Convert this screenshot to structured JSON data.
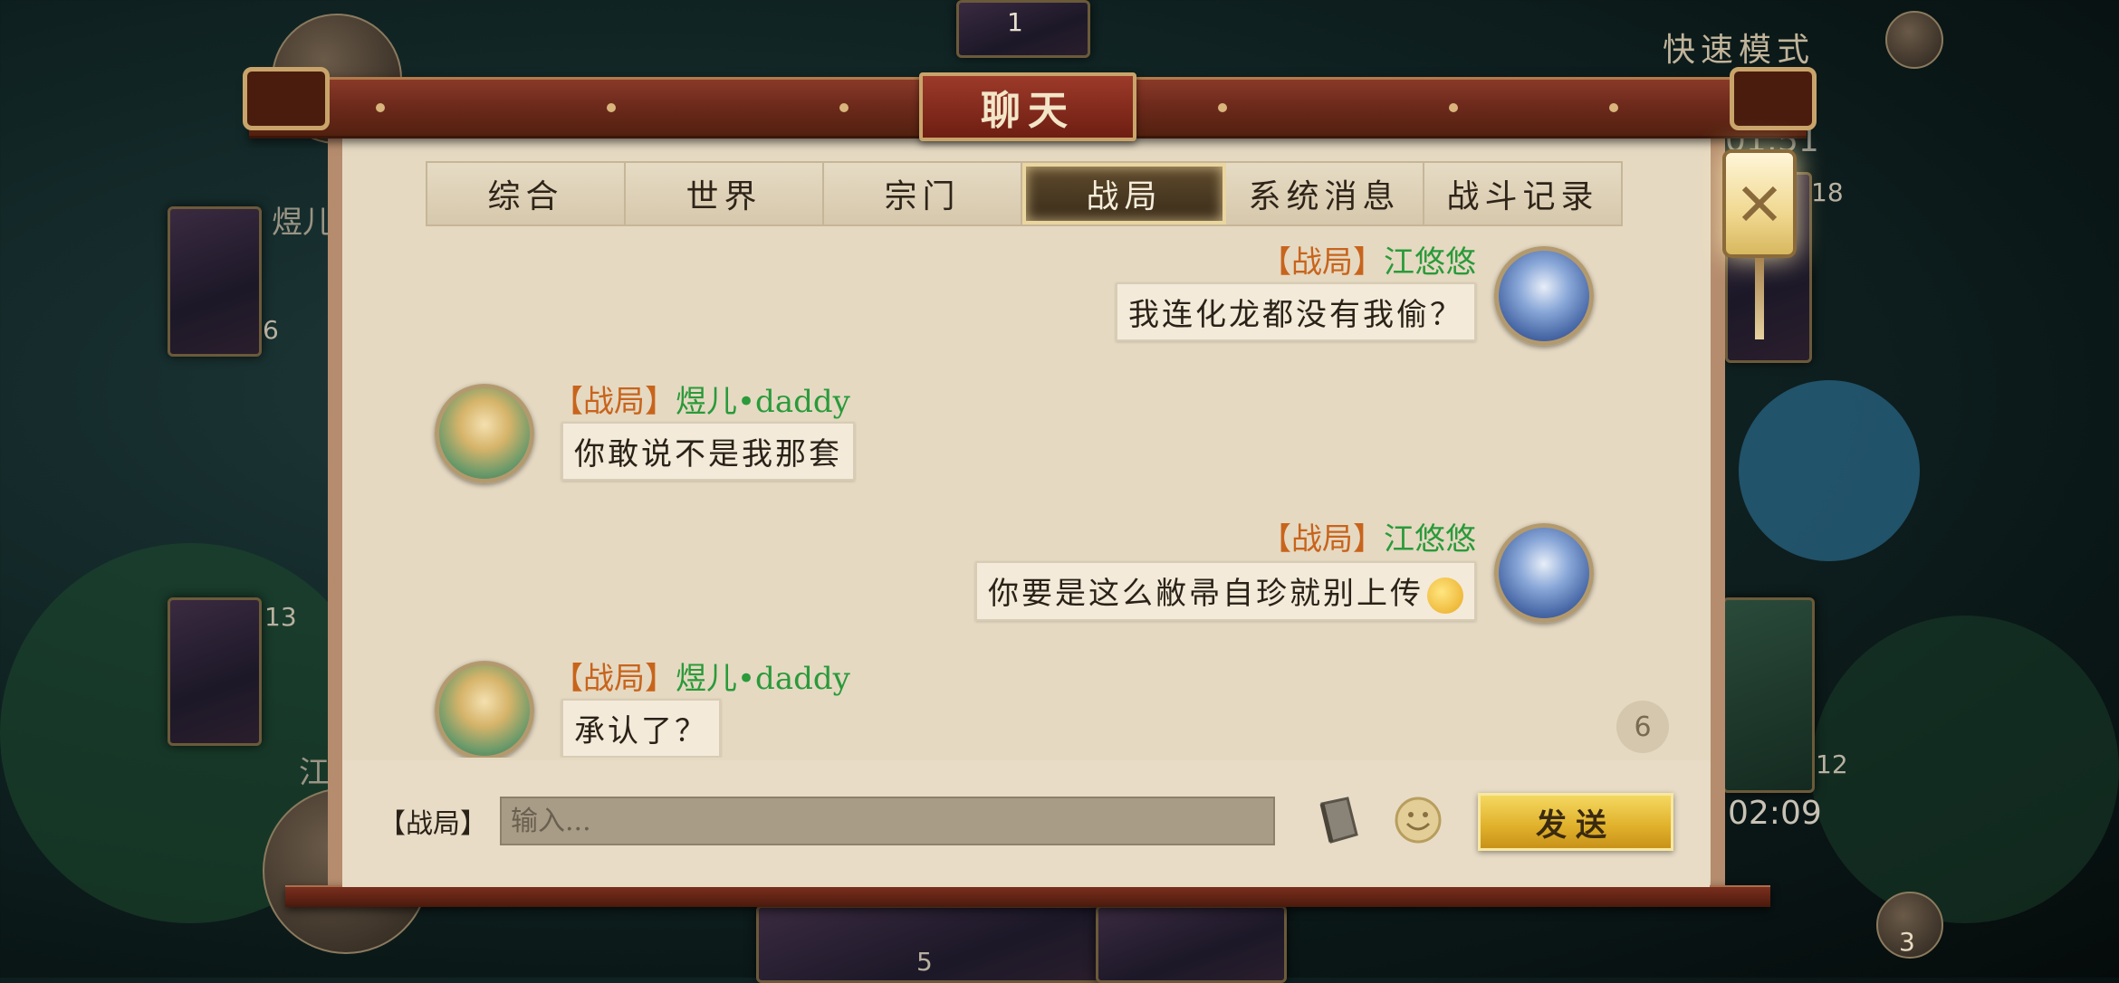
{
  "background": {
    "mode_label": "快速模式",
    "left_player_name": "煜儿",
    "left_card_count_top": "6",
    "left_card_count_bottom": "13",
    "top_card_count": "1",
    "right_card_count_top": "18",
    "right_card_count_bottom": "12",
    "right_player_name_partial": "江",
    "timer": "02:09",
    "timer_partial": "01:51",
    "bottom_card_count": "5",
    "bottom_right_count": "3"
  },
  "dialog": {
    "title": "聊天",
    "close_label": "关闭"
  },
  "tabs": [
    {
      "label": "综合",
      "active": false
    },
    {
      "label": "世界",
      "active": false
    },
    {
      "label": "宗门",
      "active": false
    },
    {
      "label": "战局",
      "active": true
    },
    {
      "label": "系统消息",
      "active": false
    },
    {
      "label": "战斗记录",
      "active": false
    }
  ],
  "messages": [
    {
      "side": "right",
      "channel": "【战局】",
      "user": "江悠悠",
      "text": "我连化龙都没有我偷？",
      "avatar": "male"
    },
    {
      "side": "left",
      "channel": "【战局】",
      "user": "煜儿•daddy",
      "text": "你敢说不是我那套",
      "avatar": "female"
    },
    {
      "side": "right",
      "channel": "【战局】",
      "user": "江悠悠",
      "text": "你要是这么敝帚自珍就别上传",
      "avatar": "male",
      "emoji": "thinking-emoji"
    },
    {
      "side": "left",
      "channel": "【战局】",
      "user": "煜儿•daddy",
      "text": "承认了？",
      "avatar": "female"
    }
  ],
  "unread_count": "6",
  "input": {
    "channel_label": "【战局】",
    "placeholder": "输入...",
    "value": ""
  },
  "send_label": "发送",
  "colors": {
    "channel_tag": "#c8641c",
    "username": "#2a9a3a",
    "wood": "#6e2a1c",
    "parchment": "#e5d9c2",
    "send_gold": "#e0b02a"
  }
}
